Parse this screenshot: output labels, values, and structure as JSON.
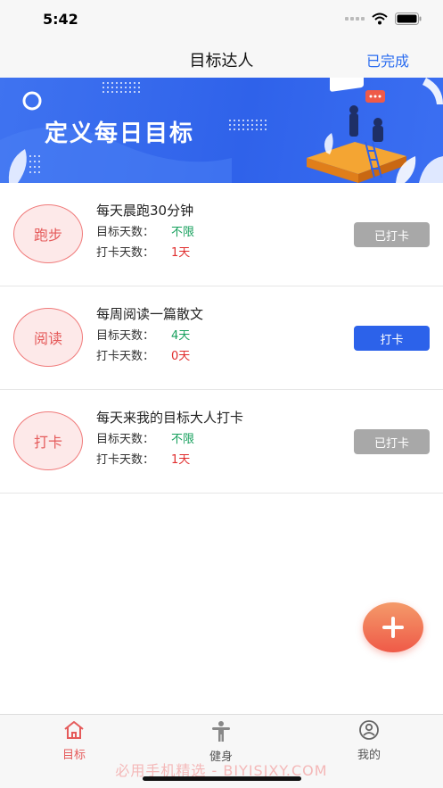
{
  "status": {
    "time": "5:42"
  },
  "nav": {
    "title": "目标达人",
    "action": "已完成"
  },
  "banner": {
    "title": "定义每日目标"
  },
  "goals": [
    {
      "badge": "跑步",
      "title": "每天晨跑30分钟",
      "target_label": "目标天数：",
      "target_value": "不限",
      "checkin_label": "打卡天数：",
      "checkin_value": "1天",
      "button": "已打卡"
    },
    {
      "badge": "阅读",
      "title": "每周阅读一篇散文",
      "target_label": "目标天数：",
      "target_value": "4天",
      "checkin_label": "打卡天数：",
      "checkin_value": "0天",
      "button": "打卡"
    },
    {
      "badge": "打卡",
      "title": "每天来我的目标大人打卡",
      "target_label": "目标天数：",
      "target_value": "不限",
      "checkin_label": "打卡天数：",
      "checkin_value": "1天",
      "button": "已打卡"
    }
  ],
  "tabs": [
    {
      "label": "目标",
      "icon": "home-icon",
      "active": true
    },
    {
      "label": "健身",
      "icon": "fitness-person-icon",
      "active": false
    },
    {
      "label": "我的",
      "icon": "profile-icon",
      "active": false
    }
  ],
  "watermark": "必用手机精选 - BIYISJXY.COM",
  "colors": {
    "accent_blue": "#2c62ea",
    "accent_red": "#e55a5a",
    "done_gray": "#a8a8a8",
    "green": "#17a05d"
  }
}
